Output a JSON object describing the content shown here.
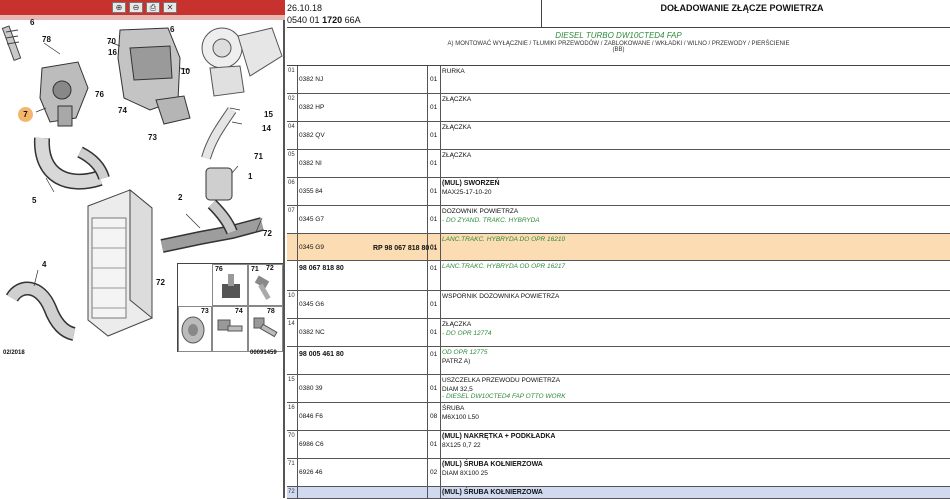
{
  "toolbar": {
    "buttons": [
      "zoom-in",
      "zoom-out",
      "print",
      "close"
    ]
  },
  "diagram": {
    "callouts": [
      "6",
      "78",
      "70",
      "16",
      "6",
      "10",
      "76",
      "74",
      "7",
      "73",
      "15",
      "14",
      "71",
      "5",
      "1",
      "2",
      "72",
      "72",
      "4"
    ],
    "footer_left": "02/2018",
    "footer_right": "00091459",
    "parts_grid": {
      "labels": [
        "76",
        "71",
        "72",
        "73",
        "74",
        "78"
      ]
    }
  },
  "header": {
    "date": "26.10.18",
    "ref_prefix": "0540 01",
    "ref_bold": "1720",
    "ref_suffix": "66A",
    "title": "DOŁADOWANIE ZŁĄCZE POWIETRZA"
  },
  "subheader": {
    "engine": "DIESEL TURBO DW10CTED4 FAP",
    "note": "A) MONTOWAĆ WYŁĄCZNIE  /  TŁUMIKI PRZEWODÓW / ZABLOKOWANE / WKŁADKI / WILNO / PRZEWODY / PIERŚCIENIE",
    "note2": "(BB)"
  },
  "rows": [
    {
      "pos": "01",
      "code": "0382 NJ",
      "qty": "01",
      "desc": "RURKA",
      "sub": "",
      "hl": ""
    },
    {
      "pos": "02",
      "code": "0382 HP",
      "qty": "01",
      "desc": "ZŁĄCZKA",
      "sub": "",
      "hl": ""
    },
    {
      "pos": "04",
      "code": "0382 QV",
      "qty": "01",
      "desc": "ZŁĄCZKA",
      "sub": "",
      "hl": ""
    },
    {
      "pos": "05",
      "code": "0382 NI",
      "qty": "01",
      "desc": "ZŁĄCZKA",
      "sub": "",
      "hl": ""
    },
    {
      "pos": "06",
      "code": "0355 84",
      "qty": "01",
      "desc": "(MUL) SWORZEŃ",
      "sub": "MAX25-17-10-20",
      "hl": ""
    },
    {
      "pos": "07",
      "code": "0345 G7",
      "qty": "01",
      "desc": "DOZOWNIK POWIETRZA",
      "sub": "- DO ZYAND. TRAKC. HYBRYDA",
      "hl": ""
    },
    {
      "pos": "",
      "code": "0345 G9",
      "qty": "01",
      "desc": "LANC.TRAKC. HYBRYDA DO OPR 16210",
      "sub": "",
      "hl": "orange",
      "code2": "RP 98 067 818 80",
      "qty2": "01"
    },
    {
      "pos": "",
      "code": "98 067 818 80",
      "qty": "01",
      "desc": "LANC.TRAKC. HYBRYDA OD OPR 16217",
      "sub": "",
      "hl": ""
    },
    {
      "pos": "10",
      "code": "0345 G6",
      "qty": "01",
      "desc": "WSPORNIK DOZOWNIKA POWIETRZA",
      "sub": "",
      "hl": ""
    },
    {
      "pos": "14",
      "code": "0382 NC",
      "qty": "01",
      "desc": "ZŁĄCZKA",
      "sub": "- DO OPR 12774",
      "hl": ""
    },
    {
      "pos": "",
      "code": "98 005 461 80",
      "qty": "01",
      "desc": "OD OPR 12775",
      "sub": "PATRZ A)",
      "hl": ""
    },
    {
      "pos": "15",
      "code": "0380 39",
      "qty": "01",
      "desc": "USZCZELKA PRZEWODU POWIETRZA",
      "sub": "DIAM 32,5",
      "sub2": "- DIESEL DW10CTED4 FAP OTTO WORK",
      "hl": ""
    },
    {
      "pos": "16",
      "code": "0846 F6",
      "qty": "08",
      "desc": "ŚRUBA",
      "sub": "M6X100 L50",
      "hl": ""
    },
    {
      "pos": "70",
      "code": "6986 C6",
      "qty": "01",
      "desc": "(MUL) NAKRĘTKA + PODKŁADKA",
      "sub": "8X125 0,7 22",
      "hl": ""
    },
    {
      "pos": "71",
      "code": "6926 46",
      "qty": "02",
      "desc": "(MUL) ŚRUBA KOŁNIERZOWA",
      "sub": "DIAM 8X100 25",
      "hl": ""
    },
    {
      "pos": "72",
      "code": "",
      "qty": "",
      "desc": "(MUL) ŚRUBA KOŁNIERZOWA",
      "sub": "",
      "hl": "blue"
    }
  ]
}
